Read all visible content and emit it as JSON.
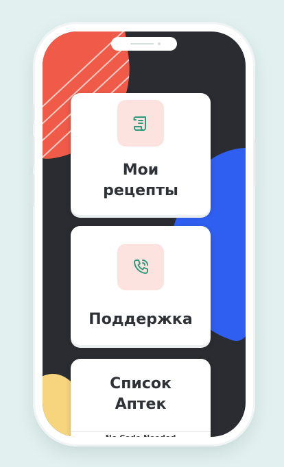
{
  "cards": [
    {
      "label_line1": "Мои",
      "label_line2": "рецепты",
      "icon": "prescription-scroll-icon"
    },
    {
      "label": "Поддержка",
      "icon": "phone-call-icon"
    },
    {
      "label_line1": "Список",
      "label_line2": "Аптек"
    }
  ],
  "footer_text": "No Code Needed",
  "colors": {
    "background": "#e2f1ef",
    "screen": "#2a2c31",
    "icon_tile": "#fde3df",
    "icon_stroke": "#2e9a7a",
    "blob_red": "#ef5b48",
    "blob_blue": "#2f5ff0",
    "blob_yellow": "#f7d57f"
  }
}
